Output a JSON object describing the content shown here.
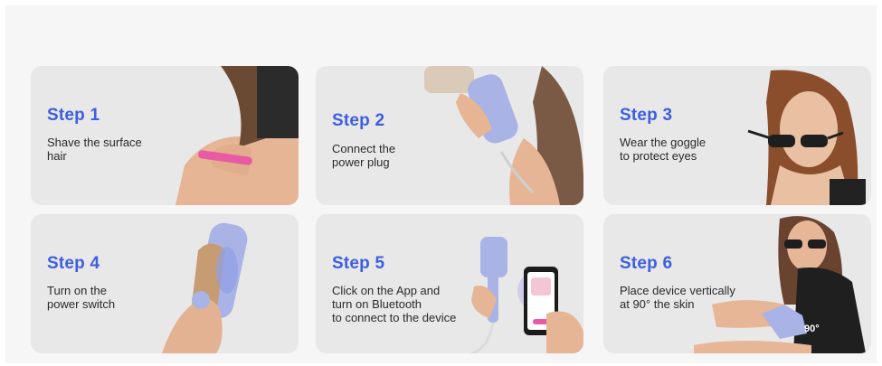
{
  "steps": [
    {
      "title": "Step 1",
      "desc": "Shave the surface\nhair"
    },
    {
      "title": "Step 2",
      "desc": "Connect the\npower plug"
    },
    {
      "title": "Step 3",
      "desc": "Wear the goggle\nto protect eyes"
    },
    {
      "title": "Step 4",
      "desc": "Turn on the\npower switch"
    },
    {
      "title": "Step 5",
      "desc": "Click on the App and\nturn on Bluetooth\nto connect to the device"
    },
    {
      "title": "Step 6",
      "desc": "Place device vertically\nat 90° the skin"
    }
  ],
  "angle_badge": "90°",
  "colors": {
    "accent": "#3d5ee0",
    "card": "#e8e8e8",
    "device": "#a9b3e6",
    "skin": "#e9b89a"
  }
}
